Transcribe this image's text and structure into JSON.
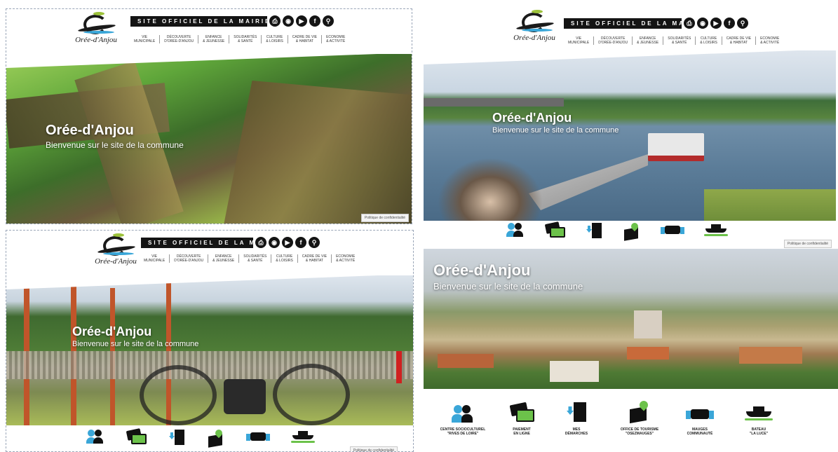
{
  "site": {
    "logo_name": "Orée-d'Anjou",
    "banner": "SITE OFFICIEL DE LA MAIRIE",
    "header_icons": [
      "print-icon",
      "eye-icon",
      "video-icon",
      "facebook-icon",
      "search-icon"
    ],
    "nav": [
      "VIE\nMUNICIPALE",
      "DÉCOUVERTE\nD'ORÉE-D'ANJOU",
      "ENFANCE\n& JEUNESSE",
      "SOLIDARITÉS\n& SANTÉ",
      "CULTURE\n& LOISIRS",
      "CADRE DE VIE\n& HABITAT",
      "ECONOMIE\n& ACTIVITÉ"
    ]
  },
  "hero": {
    "title": "Orée-d'Anjou",
    "subtitle": "Bienvenue sur le site de la commune",
    "privacy": "Politique de confidentialité"
  },
  "quick_links": [
    {
      "label": "CENTRE SOCIOCULTUREL\n\"RIVES DE LOIRE\"",
      "icon": "people-icon"
    },
    {
      "label": "PAIEMENT\nEN LIGNE",
      "icon": "payment-card-icon"
    },
    {
      "label": "MES\nDÉMARCHES",
      "icon": "document-download-icon"
    },
    {
      "label": "OFFICE DE TOURISME\n\"OSEZMAUGES\"",
      "icon": "map-pin-icon"
    },
    {
      "label": "MAUGES\nCOMMUNAUTÉ",
      "icon": "handshake-icon"
    },
    {
      "label": "BATEAU\n\"LA LUCE\"",
      "icon": "boat-icon"
    }
  ],
  "colors": {
    "dark": "#141414",
    "blue": "#3aa6d8",
    "green": "#6cc24a"
  }
}
